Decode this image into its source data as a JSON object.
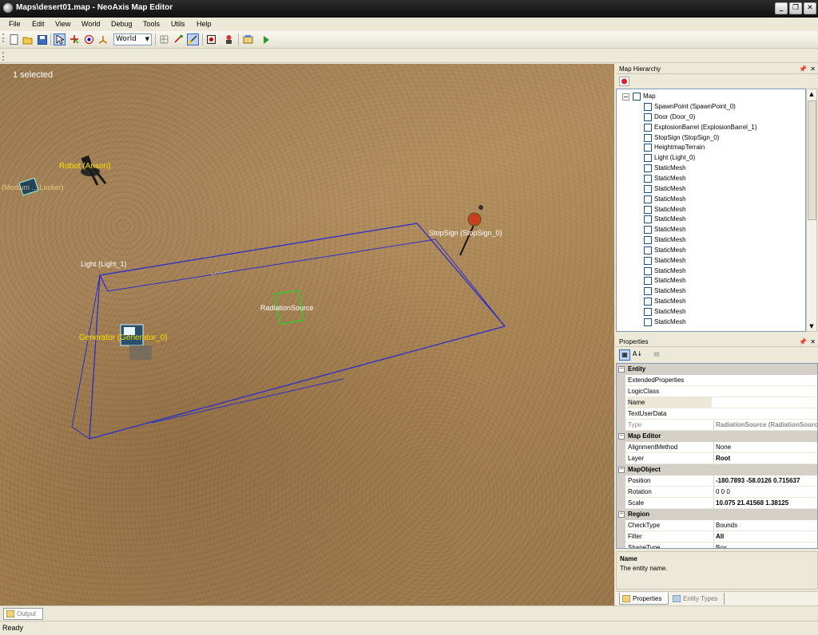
{
  "window": {
    "title": "Maps\\desert01.map - NeoAxis Map Editor"
  },
  "menu": [
    "File",
    "Edit",
    "View",
    "World",
    "Debug",
    "Tools",
    "Utils",
    "Help"
  ],
  "toolbar": {
    "coord_space": "World"
  },
  "viewport": {
    "selection_text": "1 selected",
    "labels": {
      "robot": "Robot (Anson)",
      "locker": "(Medium ... Locker)",
      "stopsign": "StopSign (StopSign_0)",
      "light": "Light (Light_1)",
      "radiation": "RadiationSource",
      "generator": "Generator (Generator_0)"
    }
  },
  "hierarchy": {
    "title": "Map Hierarchy",
    "root": "Map",
    "items": [
      "SpawnPoint (SpawnPoint_0)",
      "Door (Door_0)",
      "ExplosionBarrel (ExplosionBarrel_1)",
      "StopSign (StopSign_0)",
      "HeightmapTerrain",
      "Light (Light_0)",
      "StaticMesh",
      "StaticMesh",
      "StaticMesh",
      "StaticMesh",
      "StaticMesh",
      "StaticMesh",
      "StaticMesh",
      "StaticMesh",
      "StaticMesh",
      "StaticMesh",
      "StaticMesh",
      "StaticMesh",
      "StaticMesh",
      "StaticMesh",
      "StaticMesh",
      "StaticMesh",
      "StaticMesh"
    ]
  },
  "properties": {
    "title": "Properties",
    "categories": {
      "entity": "Entity",
      "map_editor": "Map Editor",
      "map_object": "MapObject",
      "region": "Region"
    },
    "rows": {
      "extended": {
        "key": "ExtendedProperties",
        "value": ""
      },
      "logic": {
        "key": "LogicClass",
        "value": ""
      },
      "name": {
        "key": "Name",
        "value": ""
      },
      "textuser": {
        "key": "TextUserData",
        "value": ""
      },
      "type": {
        "key": "Type",
        "value": "RadiationSource (RadiationSource)"
      },
      "alignment": {
        "key": "AlignmentMethod",
        "value": "None"
      },
      "layer": {
        "key": "Layer",
        "value": "Root"
      },
      "position": {
        "key": "Position",
        "value": "-180.7893 -58.0126 0.715637"
      },
      "rotation": {
        "key": "Rotation",
        "value": "0 0 0"
      },
      "scale": {
        "key": "Scale",
        "value": "10.075 21.41568 1.38125"
      },
      "checktype": {
        "key": "CheckType",
        "value": "Bounds"
      },
      "filter": {
        "key": "Filter",
        "value": "All"
      },
      "shapetype": {
        "key": "ShapeType",
        "value": "Box"
      }
    },
    "description": {
      "title": "Name",
      "text": "The entity name."
    },
    "tabs": [
      "Properties",
      "Entity Types"
    ]
  },
  "output_tab": "Output",
  "status": "Ready"
}
